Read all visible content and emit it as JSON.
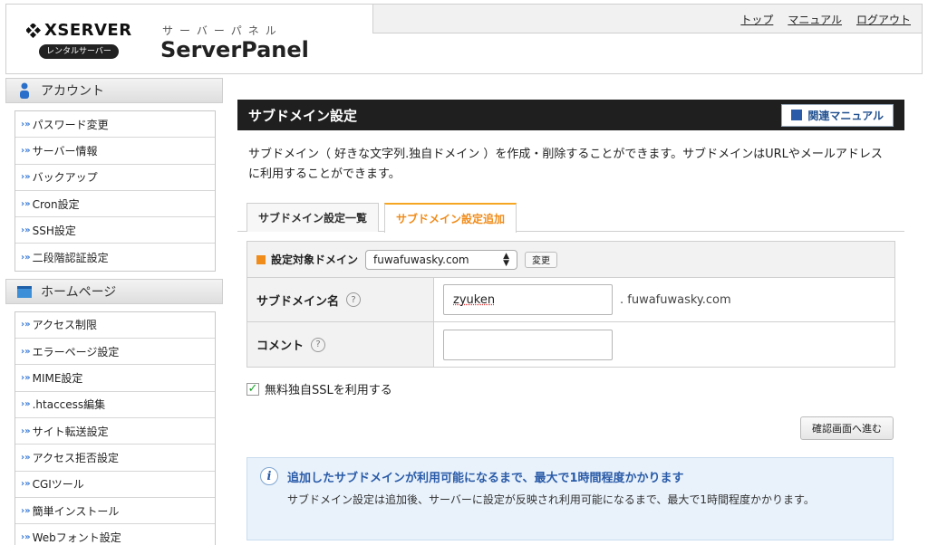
{
  "header": {
    "logo_word": "XSERVER",
    "rental_badge": "レンタルサーバー",
    "panel_kana": "サーバーパネル",
    "panel_title": "ServerPanel",
    "nav": [
      "トップ",
      "マニュアル",
      "ログアウト"
    ]
  },
  "sidebar": {
    "account_heading": "アカウント",
    "account_items": [
      "パスワード変更",
      "サーバー情報",
      "バックアップ",
      "Cron設定",
      "SSH設定",
      "二段階認証設定"
    ],
    "homepage_heading": "ホームページ",
    "homepage_items": [
      "アクセス制限",
      "エラーページ設定",
      "MIME設定",
      ".htaccess編集",
      "サイト転送設定",
      "アクセス拒否設定",
      "CGIツール",
      "簡単インストール",
      "Webフォント設定"
    ]
  },
  "main": {
    "section_title": "サブドメイン設定",
    "manual_button": "関連マニュアル",
    "description": "サブドメイン（ 好きな文字列.独自ドメイン ）を作成・削除することができます。サブドメインはURLやメールアドレスに利用することができます。",
    "tabs": [
      {
        "label": "サブドメイン設定一覧",
        "active": false
      },
      {
        "label": "サブドメイン設定追加",
        "active": true
      }
    ],
    "domain_label": "設定対象ドメイン",
    "domain_selected": "fuwafuwasky.com",
    "change_button": "変更",
    "subdomain_label": "サブドメイン名",
    "subdomain_value": "zyuken",
    "subdomain_suffix": ". fuwafuwasky.com",
    "comment_label": "コメント",
    "comment_value": "",
    "help_glyph": "?",
    "ssl_label": "無料独自SSLを利用する",
    "ssl_checked": true,
    "confirm_button": "確認画面へ進む",
    "info_title": "追加したサブドメインが利用可能になるまで、最大で1時間程度かかります",
    "info_body": "サブドメイン設定は追加後、サーバーに設定が反映され利用可能になるまで、最大で1時間程度かかります。"
  },
  "colors": {
    "accent_orange": "#f08c1a",
    "link_blue": "#2a5ba8",
    "section_bar": "#1f1f1f",
    "info_bg": "#e9f2fb"
  }
}
